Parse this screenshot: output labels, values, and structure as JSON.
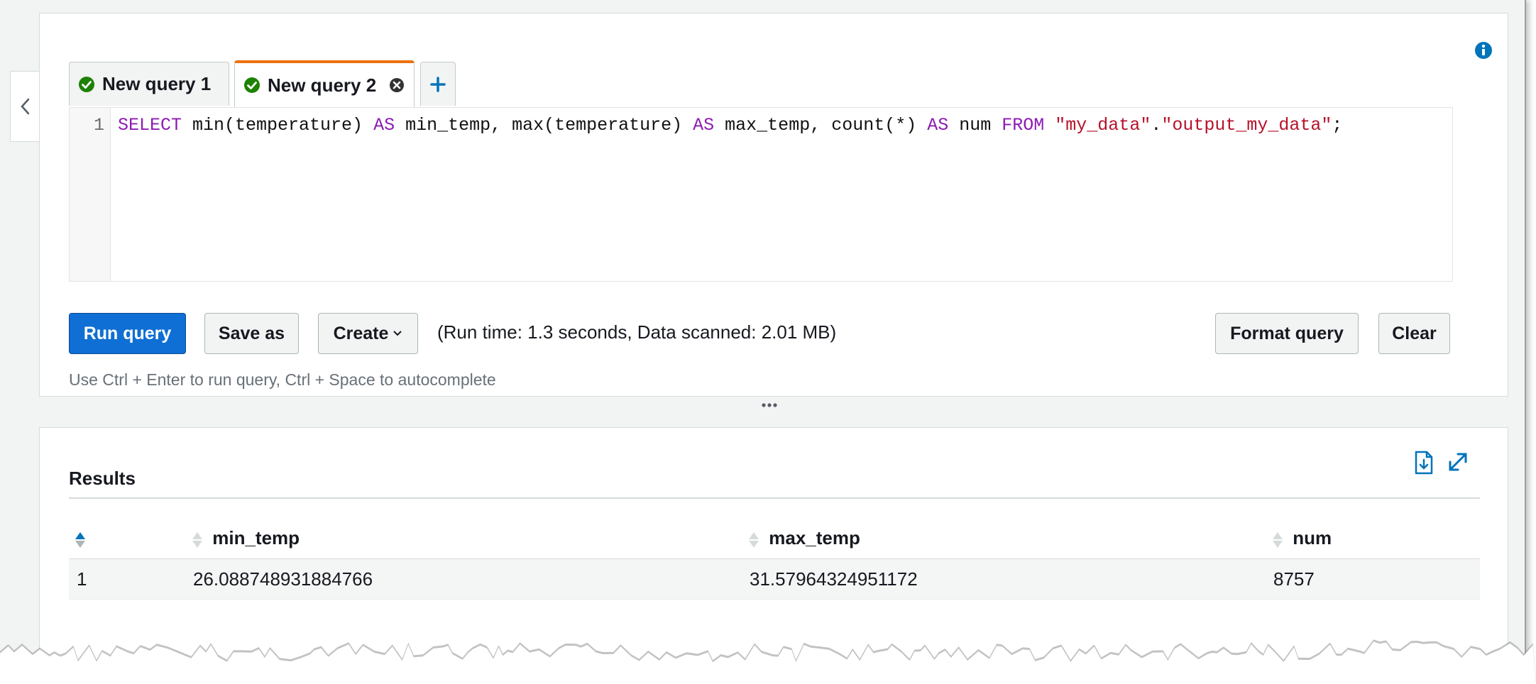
{
  "tabs": [
    {
      "label": "New query 1",
      "status": "succeeded"
    },
    {
      "label": "New query 2",
      "status": "succeeded",
      "active": true
    }
  ],
  "editor": {
    "line_number": "1",
    "tokens": [
      {
        "text": "SELECT",
        "kind": "keyword"
      },
      {
        "text": " min(temperature) ",
        "kind": "plain"
      },
      {
        "text": "AS",
        "kind": "keyword"
      },
      {
        "text": " min_temp, max(temperature) ",
        "kind": "plain"
      },
      {
        "text": "AS",
        "kind": "keyword"
      },
      {
        "text": " max_temp, count(*) ",
        "kind": "plain"
      },
      {
        "text": "AS",
        "kind": "keyword"
      },
      {
        "text": " num ",
        "kind": "plain"
      },
      {
        "text": "FROM",
        "kind": "keyword"
      },
      {
        "text": " ",
        "kind": "plain"
      },
      {
        "text": "\"my_data\"",
        "kind": "string"
      },
      {
        "text": ".",
        "kind": "plain"
      },
      {
        "text": "\"output_my_data\"",
        "kind": "string"
      },
      {
        "text": ";",
        "kind": "plain"
      }
    ]
  },
  "toolbar": {
    "run_label": "Run query",
    "save_label": "Save as",
    "create_label": "Create",
    "run_status": "(Run time: 1.3 seconds, Data scanned: 2.01 MB)",
    "format_label": "Format query",
    "clear_label": "Clear",
    "hint": "Use Ctrl + Enter to run query, Ctrl + Space to autocomplete"
  },
  "results": {
    "title": "Results",
    "columns": [
      "",
      "min_temp",
      "max_temp",
      "num"
    ],
    "rows": [
      [
        "1",
        "26.088748931884766",
        "31.57964324951172",
        "8757"
      ]
    ]
  },
  "colors": {
    "primary_button": "#0f6fd4",
    "active_tab_accent": "#ec7211",
    "success": "#1d8102",
    "keyword": "#8d1bb3",
    "string": "#b6122a",
    "link_icon": "#0073bb"
  },
  "icons": {
    "info": "info-icon",
    "collapse": "chevron-left-icon",
    "tab_status": "check-circle-icon",
    "tab_close": "close-circle-icon",
    "add_tab": "plus-icon",
    "download": "download-csv-icon",
    "expand": "expand-icon",
    "sort": "sort-icon"
  }
}
